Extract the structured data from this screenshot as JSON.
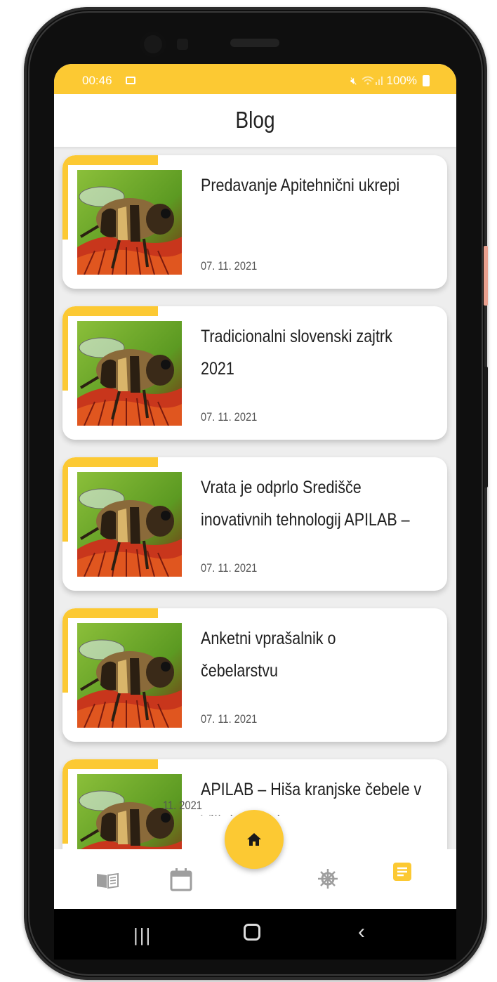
{
  "status_bar": {
    "time": "00:46",
    "battery": "100%"
  },
  "header": {
    "title": "Blog"
  },
  "posts": [
    {
      "title_lines": [
        "Predavanje Apitehnični ukrepi"
      ],
      "date": "07. 11. 2021"
    },
    {
      "title_lines": [
        "Tradicionalni slovenski zajtrk",
        "2021"
      ],
      "date": "07. 11. 2021"
    },
    {
      "title_lines": [
        "Vrata je odprlo Središče",
        "inovativnih tehnologij APILAB –"
      ],
      "date": "07. 11. 2021"
    },
    {
      "title_lines": [
        "Anketni vprašalnik o",
        "čebelarstvu"
      ],
      "date": "07. 11. 2021"
    },
    {
      "title_lines": [
        "APILAB – Hiša kranjske čebele v",
        "Višnj… vabi…"
      ],
      "date": "11. 2021"
    }
  ],
  "bottom_nav": {
    "items": [
      {
        "icon": "book-icon",
        "active": false
      },
      {
        "icon": "calendar-icon",
        "active": false
      },
      {
        "icon": "home-icon",
        "active": false
      },
      {
        "icon": "ship-wheel-icon",
        "active": false
      },
      {
        "icon": "article-icon",
        "active": true
      }
    ]
  },
  "colors": {
    "accent": "#fcc933",
    "inactive_icon": "#9e9e9e",
    "background": "#eeeeee"
  }
}
